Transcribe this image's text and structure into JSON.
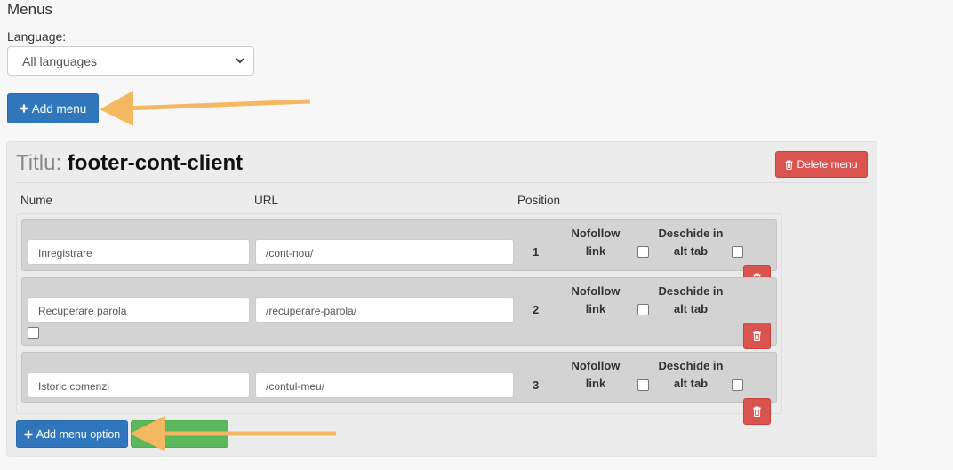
{
  "page": {
    "title": "Menus"
  },
  "language": {
    "label": "Language:",
    "selected": "All languages"
  },
  "add_menu_label": "Add menu",
  "menu": {
    "title_prefix": "Titlu:",
    "name": "footer-cont-client",
    "delete_label": "Delete menu",
    "columns": {
      "name": "Nume",
      "url": "URL",
      "position": "Position"
    },
    "options": [
      {
        "name": "Inregistrare",
        "url": "/cont-nou/",
        "position": "1",
        "nofollow": false,
        "new_tab": false
      },
      {
        "name": "Recuperare parola",
        "url": "/recuperare-parola/",
        "position": "2",
        "nofollow": false,
        "new_tab": false
      },
      {
        "name": "Istoric comenzi",
        "url": "/contul-meu/",
        "position": "3",
        "nofollow": false,
        "new_tab": false
      }
    ],
    "nofollow_label_1": "Nofollow",
    "nofollow_label_2": "link",
    "newtab_label_1": "Deschide in",
    "newtab_label_2": "alt tab",
    "add_option_label": "Add menu option"
  },
  "colors": {
    "primary": "#2f76bd",
    "danger": "#d9534f",
    "success": "#5cb85c",
    "annotation_arrow": "#f5b862"
  },
  "icons": {
    "plus": "plus-icon",
    "trash": "trash-icon",
    "chevron": "chevron-down-icon"
  }
}
